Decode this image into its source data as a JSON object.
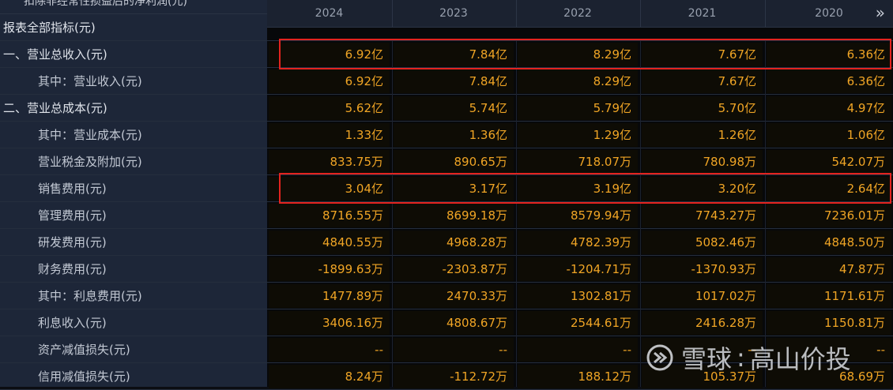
{
  "header": {
    "top_label": "扣除非经常性损益后的净利润(元)",
    "years": [
      "2024",
      "2023",
      "2022",
      "2021",
      "2020"
    ],
    "nav_glyph": "»"
  },
  "section_title": "报表全部指标(元)",
  "rows": [
    {
      "label": "一、营业总收入(元)",
      "level": "top",
      "values": [
        "6.92亿",
        "7.84亿",
        "8.29亿",
        "7.67亿",
        "6.36亿"
      ]
    },
    {
      "label": "其中：营业收入(元)",
      "level": "sub",
      "values": [
        "6.92亿",
        "7.84亿",
        "8.29亿",
        "7.67亿",
        "6.36亿"
      ]
    },
    {
      "label": "二、营业总成本(元)",
      "level": "top",
      "values": [
        "5.62亿",
        "5.74亿",
        "5.79亿",
        "5.70亿",
        "4.97亿"
      ]
    },
    {
      "label": "其中：营业成本(元)",
      "level": "sub",
      "values": [
        "1.33亿",
        "1.36亿",
        "1.29亿",
        "1.26亿",
        "1.06亿"
      ]
    },
    {
      "label": "营业税金及附加(元)",
      "level": "sub",
      "values": [
        "833.75万",
        "890.65万",
        "718.07万",
        "780.98万",
        "542.07万"
      ]
    },
    {
      "label": "销售费用(元)",
      "level": "sub",
      "values": [
        "3.04亿",
        "3.17亿",
        "3.19亿",
        "3.20亿",
        "2.64亿"
      ]
    },
    {
      "label": "管理费用(元)",
      "level": "sub",
      "values": [
        "8716.55万",
        "8699.18万",
        "8579.94万",
        "7743.27万",
        "7236.01万"
      ]
    },
    {
      "label": "研发费用(元)",
      "level": "sub",
      "values": [
        "4840.55万",
        "4968.28万",
        "4782.39万",
        "5082.46万",
        "4848.50万"
      ]
    },
    {
      "label": "财务费用(元)",
      "level": "sub",
      "values": [
        "-1899.63万",
        "-2303.87万",
        "-1204.71万",
        "-1370.93万",
        "47.87万"
      ]
    },
    {
      "label": "其中：利息费用(元)",
      "level": "sub",
      "values": [
        "1477.89万",
        "2470.33万",
        "1302.81万",
        "1017.02万",
        "1171.61万"
      ]
    },
    {
      "label": "利息收入(元)",
      "level": "sub",
      "values": [
        "3406.16万",
        "4808.67万",
        "2544.61万",
        "2416.28万",
        "1150.81万"
      ]
    },
    {
      "label": "资产减值损失(元)",
      "level": "sub",
      "values": [
        "--",
        "--",
        "--",
        "--",
        "--"
      ]
    },
    {
      "label": "信用减值损失(元)",
      "level": "sub",
      "values": [
        "8.24万",
        "-112.72万",
        "188.12万",
        "105.37万",
        "68.69万"
      ]
    }
  ],
  "highlighted_rows": [
    "一、营业总收入(元)",
    "销售费用(元)"
  ],
  "watermark": {
    "brand": "雪球",
    "separator": ":",
    "author": "高山价投"
  },
  "colors": {
    "value": "#f0a525",
    "highlight": "#e3231f",
    "label_panel": "#1d2638"
  }
}
